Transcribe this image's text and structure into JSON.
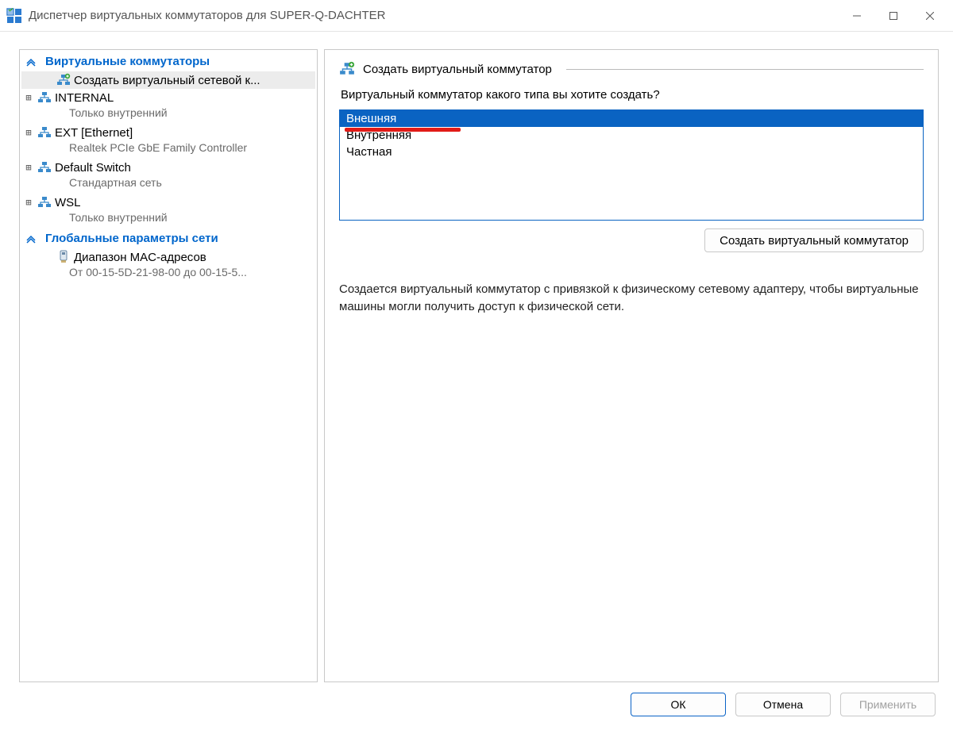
{
  "window": {
    "title": "Диспетчер виртуальных коммутаторов для SUPER-Q-DACHTER"
  },
  "sidebar": {
    "section_switches": "Виртуальные коммутаторы",
    "create_item": "Создать виртуальный сетевой к...",
    "items": [
      {
        "name": "INTERNAL",
        "detail": "Только внутренний"
      },
      {
        "name": "EXT [Ethernet]",
        "detail": "Realtek PCIe GbE Family Controller"
      },
      {
        "name": "Default Switch",
        "detail": "Стандартная сеть"
      },
      {
        "name": "WSL",
        "detail": "Только внутренний"
      }
    ],
    "section_global": "Глобальные параметры сети",
    "mac_label": "Диапазон MAC-адресов",
    "mac_detail": "От 00-15-5D-21-98-00 до 00-15-5..."
  },
  "main": {
    "header": "Создать виртуальный коммутатор",
    "question": "Виртуальный коммутатор какого типа вы хотите создать?",
    "options": [
      "Внешняя",
      "Внутренняя",
      "Частная"
    ],
    "create_button": "Создать виртуальный коммутатор",
    "description": "Создается виртуальный коммутатор с привязкой к физическому сетевому адаптеру, чтобы виртуальные машины могли получить доступ к физической сети."
  },
  "footer": {
    "ok": "ОК",
    "cancel": "Отмена",
    "apply": "Применить"
  }
}
